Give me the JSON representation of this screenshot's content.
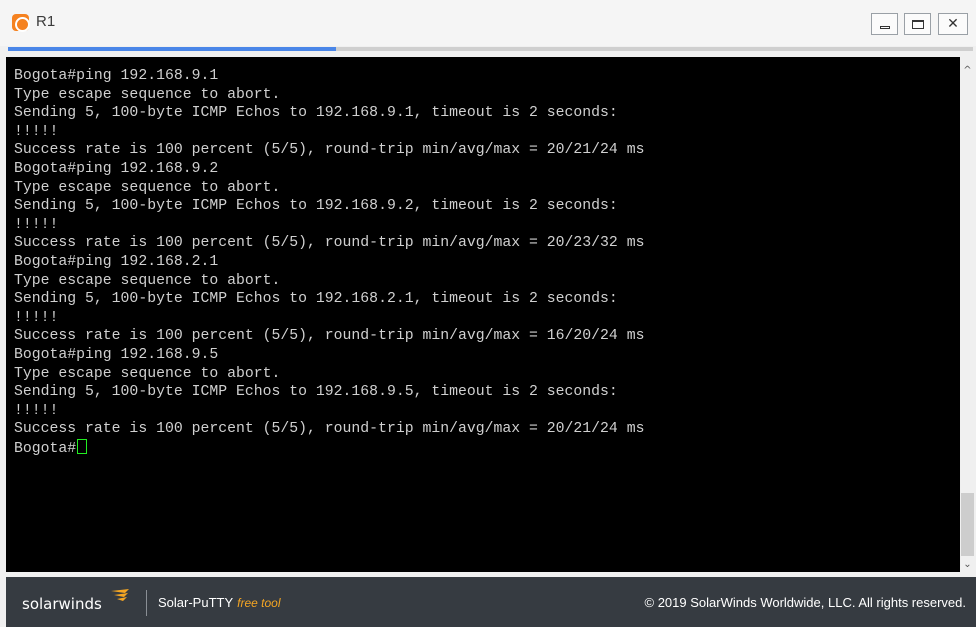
{
  "window": {
    "title": "R1",
    "minimize_icon": "minimize-icon",
    "maximize_icon": "maximize-icon",
    "close_glyph": "✕"
  },
  "terminal": {
    "lines": [
      "Bogota#ping 192.168.9.1",
      "Type escape sequence to abort.",
      "Sending 5, 100-byte ICMP Echos to 192.168.9.1, timeout is 2 seconds:",
      "!!!!!",
      "Success rate is 100 percent (5/5), round-trip min/avg/max = 20/21/24 ms",
      "Bogota#ping 192.168.9.2",
      "Type escape sequence to abort.",
      "Sending 5, 100-byte ICMP Echos to 192.168.9.2, timeout is 2 seconds:",
      "!!!!!",
      "Success rate is 100 percent (5/5), round-trip min/avg/max = 20/23/32 ms",
      "Bogota#ping 192.168.2.1",
      "Type escape sequence to abort.",
      "Sending 5, 100-byte ICMP Echos to 192.168.2.1, timeout is 2 seconds:",
      "!!!!!",
      "Success rate is 100 percent (5/5), round-trip min/avg/max = 16/20/24 ms",
      "Bogota#ping 192.168.9.5",
      "Type escape sequence to abort.",
      "Sending 5, 100-byte ICMP Echos to 192.168.9.5, timeout is 2 seconds:",
      "!!!!!",
      "Success rate is 100 percent (5/5), round-trip min/avg/max = 20/21/24 ms"
    ],
    "prompt": "Bogota#"
  },
  "footer": {
    "brand": "solarwinds",
    "product": "Solar-PuTTY",
    "tag": "free tool",
    "copyright": "© 2019 SolarWinds Worldwide, LLC. All rights reserved."
  },
  "colors": {
    "terminal_bg": "#000000",
    "terminal_text": "#d0d0d0",
    "cursor": "#22ee22",
    "footer_bg": "#363b41",
    "accent_orange": "#f5a623",
    "tab_active": "#4a86e8"
  }
}
